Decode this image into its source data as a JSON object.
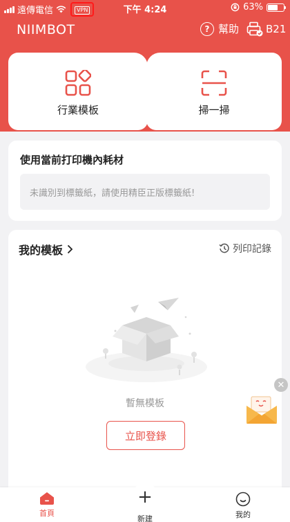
{
  "status_bar": {
    "carrier": "遠傳電信",
    "vpn": "VPN",
    "time": "下午 4:24",
    "battery": "63%",
    "battery_level": 0.63
  },
  "header": {
    "logo": "NIIMBOT",
    "help_label": "幫助",
    "printer_model": "B21"
  },
  "actions": {
    "industry_templates": "行業模板",
    "scan": "掃一掃"
  },
  "consumables": {
    "title": "使用當前打印機內耗材",
    "message": "未識別到標籤紙，請使用精臣正版標籤紙!"
  },
  "templates": {
    "title": "我的模板",
    "print_record": "列印記錄",
    "empty_text": "暫無模板",
    "login_button": "立即登錄"
  },
  "bottom_nav": {
    "home": "首頁",
    "new": "新建",
    "mine": "我的"
  },
  "colors": {
    "accent": "#e8524a",
    "background": "#f2f2f4"
  }
}
